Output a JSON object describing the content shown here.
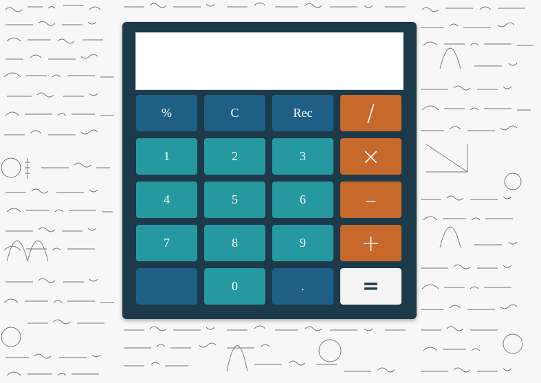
{
  "display": {
    "value": ""
  },
  "keys": {
    "percent": "%",
    "clear": "C",
    "rec": "Rec",
    "divide": "/",
    "one": "1",
    "two": "2",
    "three": "3",
    "multiply": "×",
    "four": "4",
    "five": "5",
    "six": "6",
    "subtract": "–",
    "seven": "7",
    "eight": "8",
    "nine": "9",
    "add": "+",
    "blank": "",
    "zero": "0",
    "decimal": ".",
    "equals": "="
  },
  "colors": {
    "body": "#1c3a4a",
    "function_key": "#1f5f85",
    "number_key": "#2699a0",
    "operator_key": "#c7692b",
    "equals_key": "#f4f4f4",
    "display_background": "#ffffff"
  }
}
